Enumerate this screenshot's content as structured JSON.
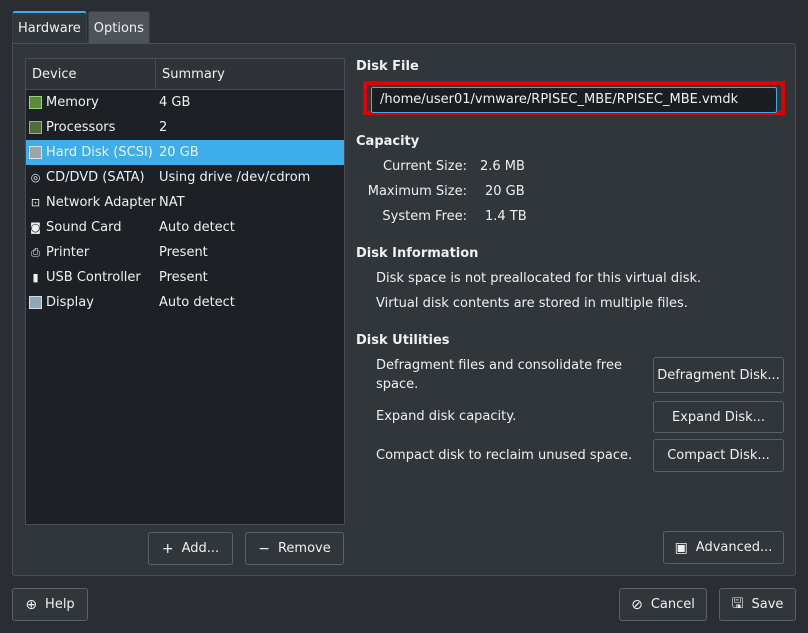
{
  "tabs": [
    {
      "label": "Hardware"
    },
    {
      "label": "Options"
    }
  ],
  "device_list": {
    "headers": {
      "device": "Device",
      "summary": "Summary"
    },
    "rows": [
      {
        "device": "Memory",
        "summary": "4 GB",
        "icon": "memory-icon"
      },
      {
        "device": "Processors",
        "summary": "2",
        "icon": "cpu-icon"
      },
      {
        "device": "Hard Disk (SCSI)",
        "summary": "20 GB",
        "icon": "hard-disk-icon",
        "selected": true
      },
      {
        "device": "CD/DVD (SATA)",
        "summary": "Using drive /dev/cdrom",
        "icon": "cdrom-icon"
      },
      {
        "device": "Network Adapter",
        "summary": "NAT",
        "icon": "network-icon"
      },
      {
        "device": "Sound Card",
        "summary": "Auto detect",
        "icon": "sound-icon"
      },
      {
        "device": "Printer",
        "summary": "Present",
        "icon": "printer-icon"
      },
      {
        "device": "USB Controller",
        "summary": "Present",
        "icon": "usb-icon"
      },
      {
        "device": "Display",
        "summary": "Auto detect",
        "icon": "display-icon"
      }
    ],
    "add_label": "Add...",
    "remove_label": "Remove"
  },
  "disk_file": {
    "heading": "Disk File",
    "path": "/home/user01/vmware/RPISEC_MBE/RPISEC_MBE.vmdk"
  },
  "capacity": {
    "heading": "Capacity",
    "current_label": "Current Size:",
    "current_value": "2.6 MB",
    "maximum_label": "Maximum Size:",
    "maximum_value": "20 GB",
    "free_label": "System Free:",
    "free_value": "1.4 TB"
  },
  "disk_info": {
    "heading": "Disk Information",
    "line1": "Disk space is not preallocated for this virtual disk.",
    "line2": "Virtual disk contents are stored in multiple files."
  },
  "disk_utilities": {
    "heading": "Disk Utilities",
    "defrag_desc_1": "Defragment files and consolidate free",
    "defrag_desc_2": "space.",
    "defrag_button": "Defragment Disk...",
    "expand_desc": "Expand disk capacity.",
    "expand_button": "Expand Disk...",
    "compact_desc": "Compact disk to reclaim unused space.",
    "compact_button": "Compact Disk..."
  },
  "advanced_label": "Advanced...",
  "footer": {
    "help": "Help",
    "cancel": "Cancel",
    "save": "Save"
  },
  "colors": {
    "accent": "#3daee9",
    "highlight": "#e00000"
  }
}
